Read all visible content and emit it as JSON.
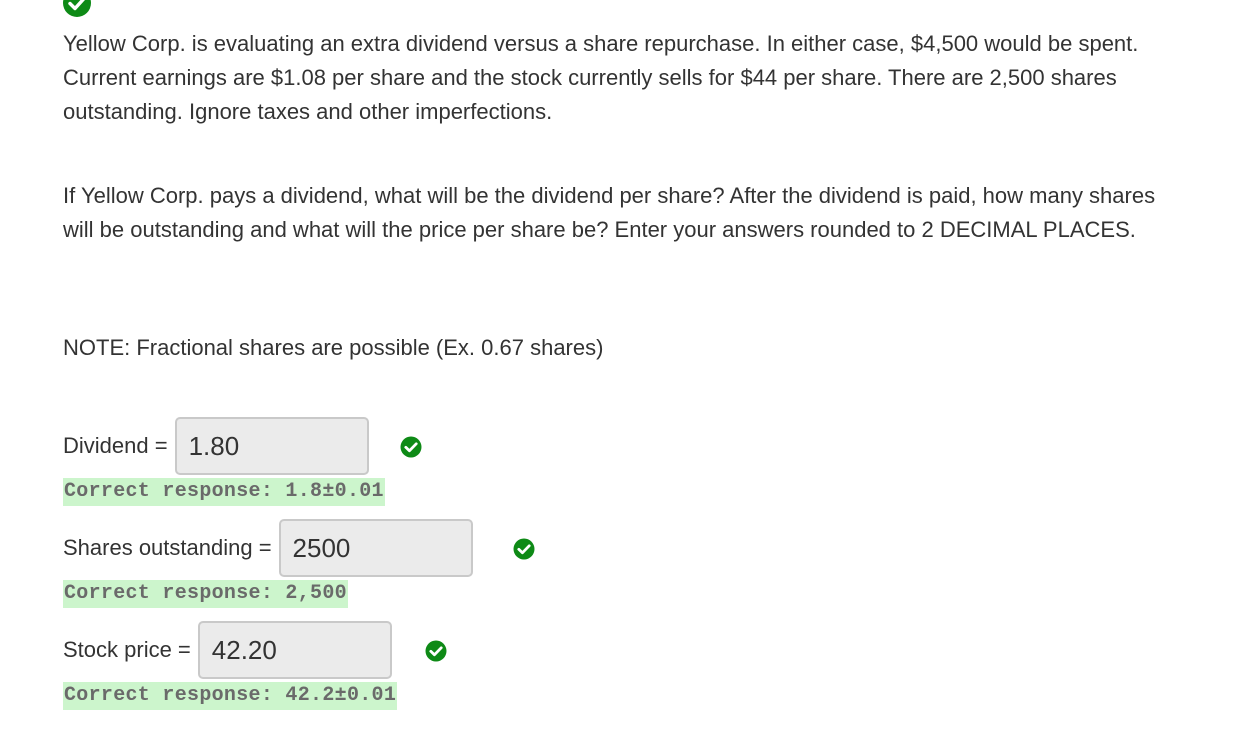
{
  "question": {
    "intro": "Yellow Corp. is evaluating an extra dividend versus a share repurchase. In either case, $4,500 would be spent. Current earnings are $1.08 per share and the stock currently sells for $44 per share. There are 2,500 shares outstanding. Ignore taxes and other imperfections.",
    "prompt": "If Yellow Corp. pays a dividend, what will be the dividend per share? After the dividend is paid, how many shares will be outstanding and what will the price per share be? Enter your answers rounded to 2 DECIMAL PLACES.",
    "note": "NOTE: Fractional shares are possible (Ex. 0.67 shares)"
  },
  "answers": [
    {
      "label": "Dividend =",
      "value": "1.80",
      "correct_response": "Correct response: 1.8±0.01",
      "status_icon": "check-circle-icon"
    },
    {
      "label": "Shares outstanding =",
      "value": "2500",
      "correct_response": "Correct response: 2,500",
      "status_icon": "check-circle-icon"
    },
    {
      "label": "Stock price =",
      "value": "42.20",
      "correct_response": "Correct response: 42.2±0.01",
      "status_icon": "check-circle-icon"
    }
  ],
  "colors": {
    "success_green": "#0e8a16",
    "correct_bg": "#ccf5cc",
    "input_bg": "#ebebeb"
  }
}
